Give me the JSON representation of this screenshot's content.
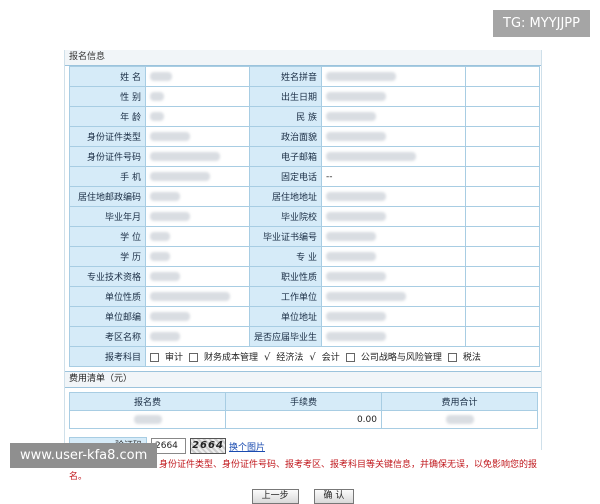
{
  "section_title": "报名信息",
  "fields": [
    [
      "姓  名",
      "",
      "姓名拼音",
      ""
    ],
    [
      "性  别",
      "",
      "出生日期",
      ""
    ],
    [
      "年  龄",
      "",
      "民  族",
      ""
    ],
    [
      "身份证件类型",
      "",
      "政治面貌",
      ""
    ],
    [
      "身份证件号码",
      "",
      "电子邮箱",
      ""
    ],
    [
      "手  机",
      "",
      "固定电话",
      "--"
    ],
    [
      "居住地邮政编码",
      "",
      "居住地地址",
      ""
    ],
    [
      "毕业年月",
      "",
      "毕业院校",
      ""
    ],
    [
      "学  位",
      "",
      "毕业证书编号",
      ""
    ],
    [
      "学  历",
      "",
      "专  业",
      ""
    ],
    [
      "专业技术资格",
      "",
      "职业性质",
      ""
    ],
    [
      "单位性质",
      "",
      "工作单位",
      ""
    ],
    [
      "单位邮编",
      "",
      "单位地址",
      ""
    ],
    [
      "考区名称",
      "",
      "是否应届毕业生",
      ""
    ]
  ],
  "subjects_label": "报考科目",
  "subjects": [
    {
      "label": "审计",
      "checked": false
    },
    {
      "label": "财务成本管理",
      "checked": false
    },
    {
      "label": "经济法",
      "checked": true
    },
    {
      "label": "会计",
      "checked": true
    },
    {
      "label": "公司战略与风险管理",
      "checked": false
    },
    {
      "label": "税法",
      "checked": false
    }
  ],
  "fee_title": "费用清单（元）",
  "fee_headers": [
    "报名费",
    "手续费",
    "费用合计"
  ],
  "fee_values": [
    "",
    "0.00",
    ""
  ],
  "captcha": {
    "label": "验证码",
    "input_value": "2664",
    "image_text": "2664",
    "refresh_link": "换个图片"
  },
  "warning": "请仔细确认您的姓名、身份证件类型、身份证件号码、报考考区、报考科目等关键信息，并确保无误，以免影响您的报名。",
  "buttons": {
    "prev": "上一步",
    "confirm": "确  认"
  },
  "watermark_tg": "TG: MYYJJPP",
  "watermark_url": "www.user-kfa8.com"
}
